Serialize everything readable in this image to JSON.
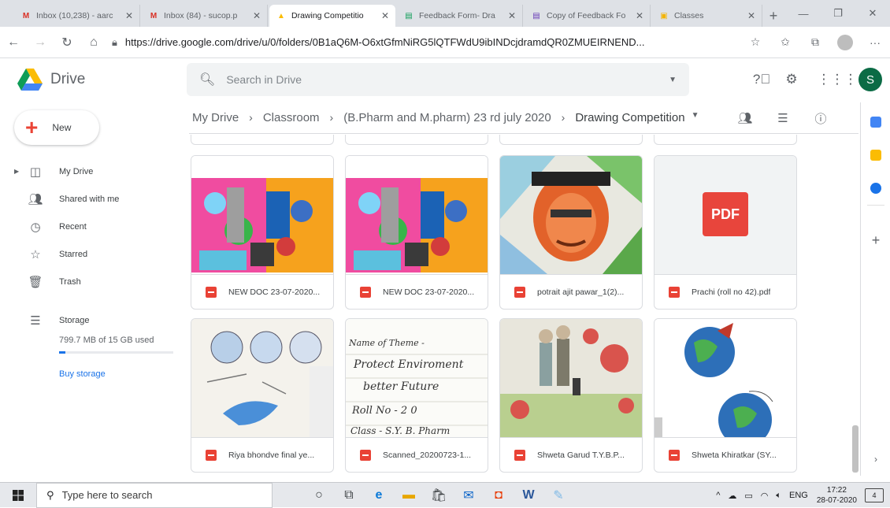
{
  "browser": {
    "tabs": [
      {
        "title": "Inbox (10,238) - aarc",
        "favicon": "gmail-icon",
        "color": "#d93025",
        "active": false
      },
      {
        "title": "Inbox (84) - sucop.p",
        "favicon": "gmail-icon",
        "color": "#d93025",
        "active": false
      },
      {
        "title": "Drawing Competitio",
        "favicon": "drive-icon",
        "color": "#fbbc04",
        "active": true
      },
      {
        "title": "Feedback Form- Dra",
        "favicon": "forms-icon",
        "color": "#0f9d58",
        "active": false
      },
      {
        "title": "Copy of Feedback Fo",
        "favicon": "forms-icon",
        "color": "#673ab7",
        "active": false
      },
      {
        "title": "Classes",
        "favicon": "classroom-icon",
        "color": "#f4b400",
        "active": false
      }
    ],
    "url": "https://drive.google.com/drive/u/0/folders/0B1aQ6M-O6xtGfmNiRG5lQTFWdU9ibINDcjdramdQR0ZMUEIRNEND..."
  },
  "header": {
    "app_name": "Drive",
    "search_placeholder": "Search in Drive",
    "user_initial": "S"
  },
  "sidebar": {
    "new_label": "New",
    "items": [
      {
        "label": "My Drive",
        "icon": "drive-folder-icon"
      },
      {
        "label": "Shared with me",
        "icon": "people-icon"
      },
      {
        "label": "Recent",
        "icon": "clock-icon"
      },
      {
        "label": "Starred",
        "icon": "star-icon"
      },
      {
        "label": "Trash",
        "icon": "trash-icon"
      }
    ],
    "storage_label": "Storage",
    "storage_used": "799.7 MB of 15 GB used",
    "storage_fraction": 0.053,
    "buy_label": "Buy storage"
  },
  "breadcrumb": {
    "items": [
      "My Drive",
      "Classroom",
      "(B.Pharm and M.pharm) 23 rd july 2020",
      "Drawing Competition"
    ]
  },
  "files": [
    {
      "name": "NEW DOC 23-07-2020...",
      "thumb": "collage"
    },
    {
      "name": "NEW DOC 23-07-2020...",
      "thumb": "collage"
    },
    {
      "name": "potrait ajit pawar_1(2)...",
      "thumb": "portrait"
    },
    {
      "name": "Prachi (roll no 42).pdf",
      "thumb": "pdf"
    },
    {
      "name": "Riya bhondve final ye...",
      "thumb": "diagram"
    },
    {
      "name": "Scanned_20200723-1...",
      "thumb": "handwritten"
    },
    {
      "name": "Shweta Garud T.Y.B.P...",
      "thumb": "virus"
    },
    {
      "name": "Shweta Khiratkar (SY...",
      "thumb": "earth"
    }
  ],
  "pdf_badge": "PDF",
  "handwritten_lines": [
    "Name of Theme -",
    "Protect Enviroment",
    "better Future",
    "Roll No - 2 0",
    "Class - S.Y. B. Pharm"
  ],
  "taskbar": {
    "search_placeholder": "Type here to search",
    "lang": "ENG",
    "time": "17:22",
    "date": "28-07-2020",
    "notifications": "4"
  }
}
